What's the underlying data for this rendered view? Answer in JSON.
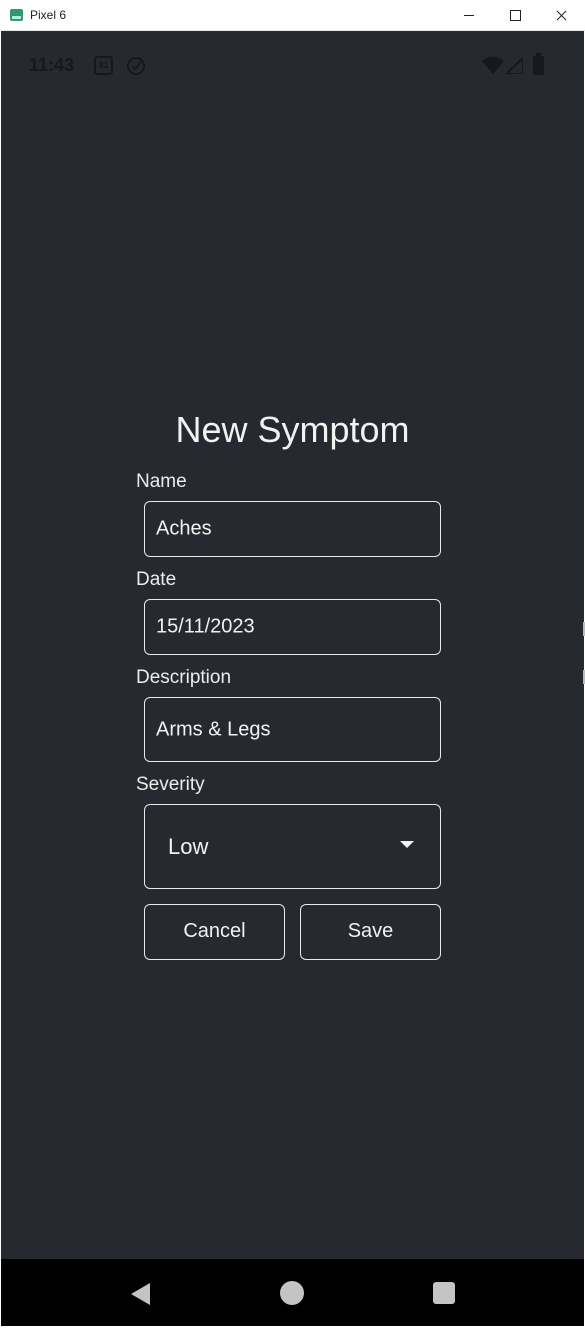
{
  "window": {
    "title": "Pixel 6"
  },
  "status_bar": {
    "time": "11:43",
    "calendar_day": "31"
  },
  "form": {
    "title": "New Symptom",
    "name": {
      "label": "Name",
      "value": "Aches"
    },
    "date": {
      "label": "Date",
      "value": "15/11/2023"
    },
    "description": {
      "label": "Description",
      "value": "Arms & Legs"
    },
    "severity": {
      "label": "Severity",
      "value": "Low"
    },
    "cancel_label": "Cancel",
    "save_label": "Save"
  },
  "colors": {
    "screen_background": "#262930",
    "text": "#f2f2f2",
    "field_border": "#e9e9e9",
    "nav_bar": "#000000"
  },
  "icons": [
    "calendar-icon",
    "check-circle-icon",
    "wifi-icon",
    "cell-signal-icon",
    "battery-icon",
    "back-icon",
    "home-icon",
    "recents-icon"
  ]
}
